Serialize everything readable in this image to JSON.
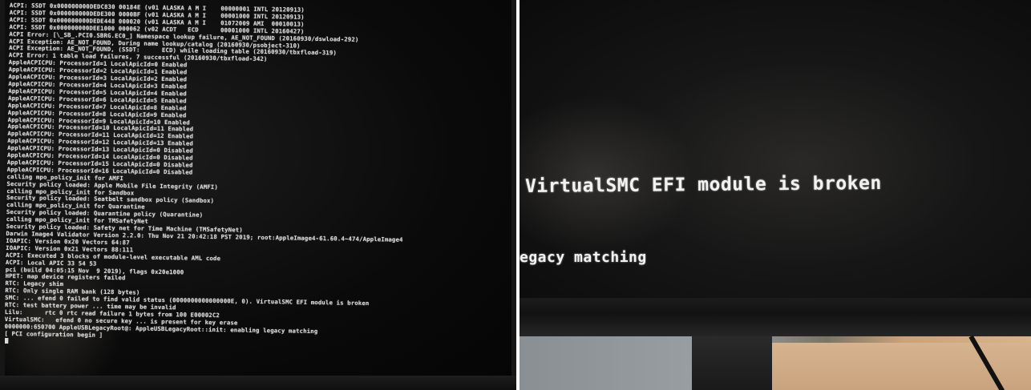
{
  "left_photo": {
    "log_lines": [
      "ACPI: SSDT 0x000000000DEDC830 00184E (v01 ALASKA A M I    00000001 INTL 20120913)",
      "ACPI: SSDT 0x000000000DEDE300 0000BF (v01 ALASKA A M I    00001000 INTL 20120913)",
      "ACPI: SSDT 0x000000000DEDE448 000020 (v01 ALASKA A M I    01072009 AMI  00010013)",
      "ACPI: SSDT 0x000000000DEE1000 000062 (v02 ACDT   ECD      00001000 INTL 20160427)",
      "ACPI Error: [\\_SB_.PCI0.SBRG.EC0_] Namespace lookup failure, AE_NOT_FOUND (20160930/dswload-292)",
      "ACPI Exception: AE_NOT_FOUND, During name lookup/catalog (20160930/psobject-310)",
      "ACPI Exception: AE_NOT_FOUND, (SSDT:      ECD) while loading table (20160930/tbxfload-319)",
      "ACPI Error: 1 table load failures, 7 successful (20160930/tbxfload-342)",
      "AppleACPICPU: ProcessorId=1 LocalApicId=0 Enabled",
      "AppleACPICPU: ProcessorId=2 LocalApicId=1 Enabled",
      "AppleACPICPU: ProcessorId=3 LocalApicId=2 Enabled",
      "AppleACPICPU: ProcessorId=4 LocalApicId=3 Enabled",
      "AppleACPICPU: ProcessorId=5 LocalApicId=4 Enabled",
      "AppleACPICPU: ProcessorId=6 LocalApicId=5 Enabled",
      "AppleACPICPU: ProcessorId=7 LocalApicId=8 Enabled",
      "AppleACPICPU: ProcessorId=8 LocalApicId=9 Enabled",
      "AppleACPICPU: ProcessorId=9 LocalApicId=10 Enabled",
      "AppleACPICPU: ProcessorId=10 LocalApicId=11 Enabled",
      "AppleACPICPU: ProcessorId=11 LocalApicId=12 Enabled",
      "AppleACPICPU: ProcessorId=12 LocalApicId=13 Enabled",
      "AppleACPICPU: ProcessorId=13 LocalApicId=0 Disabled",
      "AppleACPICPU: ProcessorId=14 LocalApicId=0 Disabled",
      "AppleACPICPU: ProcessorId=15 LocalApicId=0 Disabled",
      "AppleACPICPU: ProcessorId=16 LocalApicId=0 Disabled",
      "calling mpo_policy_init for AMFI",
      "Security policy loaded: Apple Mobile File Integrity (AMFI)",
      "calling mpo_policy_init for Sandbox",
      "Security policy loaded: Seatbelt sandbox policy (Sandbox)",
      "calling mpo_policy_init for Quarantine",
      "Security policy loaded: Quarantine policy (Quarantine)",
      "calling mpo_policy_init for TMSafetyNet",
      "Security policy loaded: Safety net for Time Machine (TMSafetyNet)",
      "Darwin Image4 Validator Version 2.2.0: Thu Nov 21 20:42:18 PST 2019; root:AppleImage4-61.60.4~474/AppleImage4",
      "IOAPIC: Version 0x20 Vectors 64:87",
      "IOAPIC: Version 0x21 Vectors 88:111",
      "ACPI: Executed 3 blocks of module-level executable AML code",
      "ACPI: Local APIC 33 54 53",
      "pci (build 04:05:15 Nov  9 2019), flags 0x20e1000",
      "HPET: map device registers failed",
      "RTC: Legacy shim",
      "RTC: Only single RAM bank (128 bytes)",
      "SMC: ... efend 0 failed to find valid status (0000000000000000E, 0). VirtualSMC EFI module is broken",
      "RTC: test battery power ... time may be invalid",
      "Lilu:      rtc 0 rtc read failure 1 bytes from 100 E00002C2",
      "VirtualSMC:   efend 0 no secure key ... is present for key erase",
      "0000000:650700 AppleUSBLegacyRoot@: AppleUSBLegacyRoot::init: enabling legacy matching",
      "[ PCI configuration begin ]"
    ]
  },
  "right_photo": {
    "message_1": "VirtualSMC EFI module is broken",
    "message_2": "egacy matching"
  }
}
